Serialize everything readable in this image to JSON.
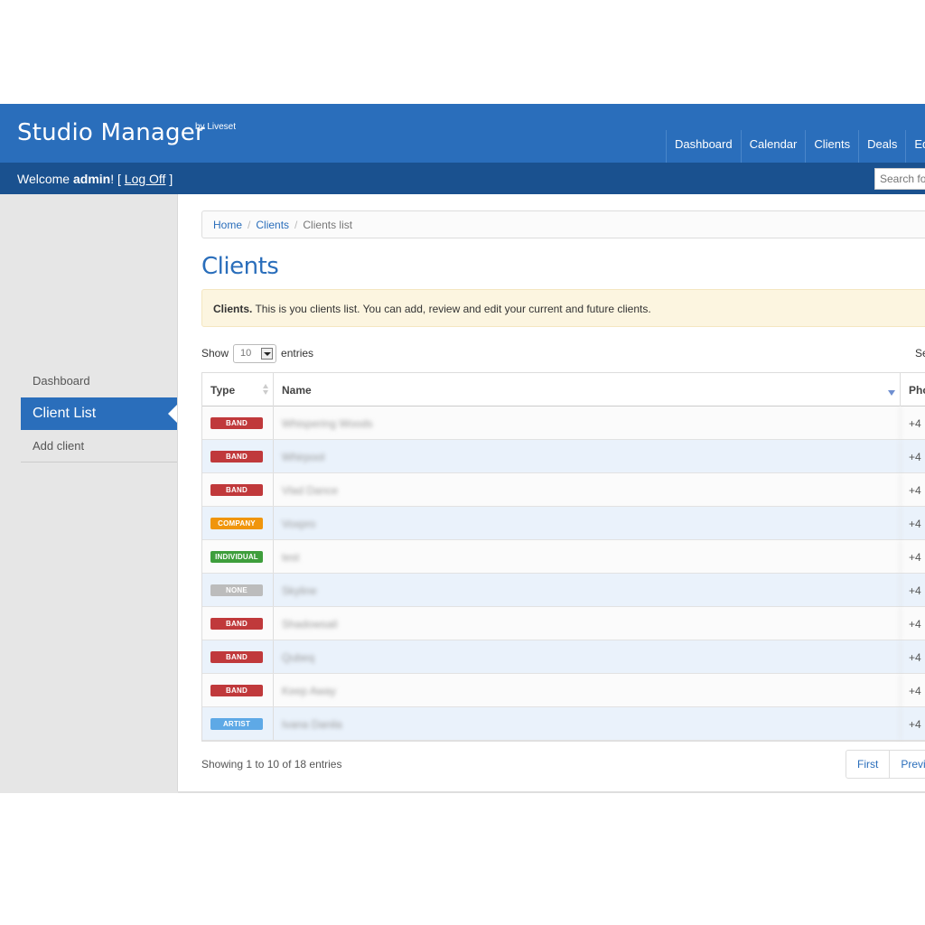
{
  "colors": {
    "header": "#2a6ebb",
    "subbar": "#1a518f",
    "accent": "#2a6ebb",
    "band": "#c0393b",
    "company": "#f0950c",
    "individual": "#3e9e3c",
    "none": "#bcbcbc",
    "artist": "#5ea9e6"
  },
  "header": {
    "brand": "Studio Manager",
    "brand_by": "by Liveset",
    "nav": [
      "Dashboard",
      "Calendar",
      "Clients",
      "Deals",
      "Eq"
    ]
  },
  "subbar": {
    "welcome": "Welcome",
    "user": "admin",
    "bang": "!",
    "open_bracket": "[",
    "logoff": "Log Off",
    "close_bracket": "]",
    "search_placeholder": "Search for"
  },
  "sidebar": {
    "items": [
      {
        "label": "Dashboard"
      },
      {
        "label": "Client List",
        "active": true
      },
      {
        "label": "Add client"
      }
    ]
  },
  "breadcrumb": {
    "home": "Home",
    "clients": "Clients",
    "sep": "/",
    "current": "Clients list"
  },
  "page": {
    "title": "Clients",
    "alert_strong": "Clients.",
    "alert_text": " This is you clients list. You can add, review and edit your current and future clients."
  },
  "table_controls": {
    "show": "Show",
    "length": "10",
    "entries": "entries",
    "search_label": "Se"
  },
  "table": {
    "columns": [
      "Type",
      "Name",
      "Pho"
    ],
    "rows": [
      {
        "type": "BAND",
        "name": "Whispering Woods",
        "phone": "+4"
      },
      {
        "type": "BAND",
        "name": "Whirpool",
        "phone": "+4"
      },
      {
        "type": "BAND",
        "name": "Vlad Dance",
        "phone": "+4"
      },
      {
        "type": "COMPANY",
        "name": "Voxpro",
        "phone": "+4"
      },
      {
        "type": "INDIVIDUAL",
        "name": "test",
        "phone": "+4"
      },
      {
        "type": "NONE",
        "name": "Skyline",
        "phone": "+4"
      },
      {
        "type": "BAND",
        "name": "Shadowsail",
        "phone": "+4"
      },
      {
        "type": "BAND",
        "name": "Qubeq",
        "phone": "+4"
      },
      {
        "type": "BAND",
        "name": "Keep Away",
        "phone": "+4"
      },
      {
        "type": "ARTIST",
        "name": "Ivana Danila",
        "phone": "+4"
      }
    ]
  },
  "footer": {
    "info": "Showing 1 to 10 of 18 entries",
    "pager": [
      "First",
      "Previ"
    ]
  }
}
